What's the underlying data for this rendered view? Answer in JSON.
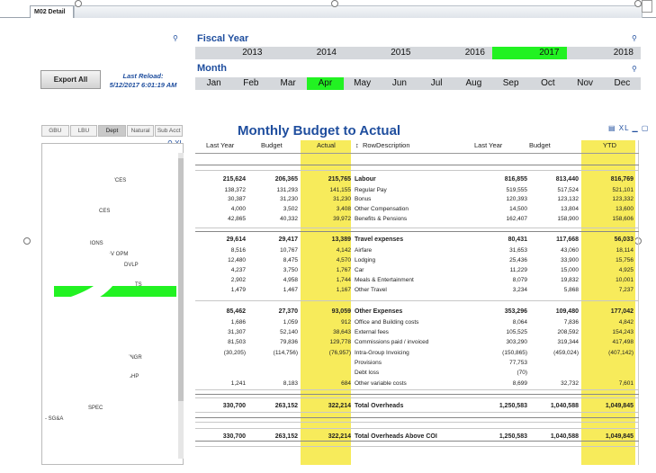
{
  "tab": {
    "label": "M02 Detail"
  },
  "left": {
    "export_label": "Export All",
    "reload_label": "Last Reload:",
    "reload_time": "5/12/2017 6:01:19 AM",
    "nav_tabs": [
      "GBU",
      "LBU",
      "Dept",
      "Natural",
      "Sub Acct"
    ],
    "nav_active": "Dept",
    "list_items": [
      "SERVICES",
      "CES",
      "IONS",
      "ON DEV OPM",
      "DVLP",
      "TS",
      "HNGR",
      "SHP",
      "SPEC",
      "- SG&A"
    ]
  },
  "fiscal_year": {
    "title": "Fiscal Year",
    "years": [
      "2013",
      "2014",
      "2015",
      "2016",
      "2017",
      "2018"
    ],
    "selected": "2017"
  },
  "month": {
    "title": "Month",
    "months": [
      "Jan",
      "Feb",
      "Mar",
      "Apr",
      "May",
      "Jun",
      "Jul",
      "Aug",
      "Sep",
      "Oct",
      "Nov",
      "Dec"
    ],
    "selected": "Apr"
  },
  "table": {
    "title": "Monthly Budget to Actual",
    "headers": [
      "Last Year",
      "Budget",
      "Actual",
      "RowDescription",
      "Last Year",
      "Budget",
      "YTD"
    ],
    "highlight_color": "#f7eb5b",
    "rows": [
      {
        "bold": true,
        "cells": [
          "215,624",
          "206,365",
          "215,765",
          "Labour",
          "816,855",
          "813,440",
          "816,769"
        ]
      },
      {
        "bold": false,
        "cells": [
          "138,372",
          "131,293",
          "141,155",
          "Regular Pay",
          "519,555",
          "517,524",
          "521,101"
        ]
      },
      {
        "bold": false,
        "cells": [
          "30,387",
          "31,230",
          "31,230",
          "Bonus",
          "120,393",
          "123,132",
          "123,332"
        ]
      },
      {
        "bold": false,
        "cells": [
          "4,000",
          "3,502",
          "3,408",
          "Other Compensation",
          "14,500",
          "13,804",
          "13,600"
        ]
      },
      {
        "bold": false,
        "cells": [
          "42,865",
          "40,332",
          "39,972",
          "Benefits & Pensions",
          "162,407",
          "158,900",
          "158,606"
        ]
      },
      {
        "bold": true,
        "cells": [
          "29,614",
          "29,417",
          "13,389",
          "Travel expenses",
          "80,431",
          "117,668",
          "56,033"
        ]
      },
      {
        "bold": false,
        "cells": [
          "8,516",
          "10,767",
          "4,142",
          "Airfare",
          "31,653",
          "43,060",
          "18,114"
        ]
      },
      {
        "bold": false,
        "cells": [
          "12,480",
          "8,475",
          "4,570",
          "Lodging",
          "25,436",
          "33,900",
          "15,756"
        ]
      },
      {
        "bold": false,
        "cells": [
          "4,237",
          "3,750",
          "1,767",
          "Car",
          "11,229",
          "15,000",
          "4,925"
        ]
      },
      {
        "bold": false,
        "cells": [
          "2,902",
          "4,958",
          "1,744",
          "Meals & Entertainment",
          "8,079",
          "19,832",
          "10,001"
        ]
      },
      {
        "bold": false,
        "cells": [
          "1,479",
          "1,467",
          "1,167",
          "Other Travel",
          "3,234",
          "5,868",
          "7,237"
        ]
      },
      {
        "bold": true,
        "cells": [
          "85,462",
          "27,370",
          "93,059",
          "Other Expenses",
          "353,296",
          "109,480",
          "177,042"
        ]
      },
      {
        "bold": false,
        "cells": [
          "1,686",
          "1,059",
          "912",
          "Office and Building costs",
          "8,064",
          "7,836",
          "4,842"
        ]
      },
      {
        "bold": false,
        "cells": [
          "31,307",
          "52,140",
          "38,643",
          "External fees",
          "105,525",
          "208,592",
          "154,243"
        ]
      },
      {
        "bold": false,
        "cells": [
          "81,503",
          "79,836",
          "129,778",
          "Commissions paid / invoiced",
          "303,290",
          "319,344",
          "417,498"
        ]
      },
      {
        "bold": false,
        "cells": [
          "(30,205)",
          "(114,756)",
          "(76,957)",
          "Intra-Group Invoicing",
          "(150,865)",
          "(459,024)",
          "(407,142)"
        ]
      },
      {
        "bold": false,
        "cells": [
          "",
          "",
          "",
          "Provisions",
          "77,753",
          "",
          ""
        ]
      },
      {
        "bold": false,
        "cells": [
          "",
          "",
          "",
          "Debt loss",
          "(70)",
          "",
          ""
        ]
      },
      {
        "bold": false,
        "cells": [
          "1,241",
          "8,183",
          "684",
          "Other variable costs",
          "8,699",
          "32,732",
          "7,601"
        ]
      },
      {
        "bold": true,
        "cells": [
          "330,700",
          "263,152",
          "322,214",
          "Total Overheads",
          "1,250,583",
          "1,040,588",
          "1,049,845"
        ]
      },
      {
        "bold": true,
        "cells": [
          "330,700",
          "263,152",
          "322,214",
          "Total Overheads Above COI",
          "1,250,583",
          "1,040,588",
          "1,049,845"
        ]
      }
    ]
  },
  "colors": {
    "accent_blue": "#1f4e9e",
    "selected_green": "#22f222",
    "grey_bar": "#d5d8dc"
  }
}
